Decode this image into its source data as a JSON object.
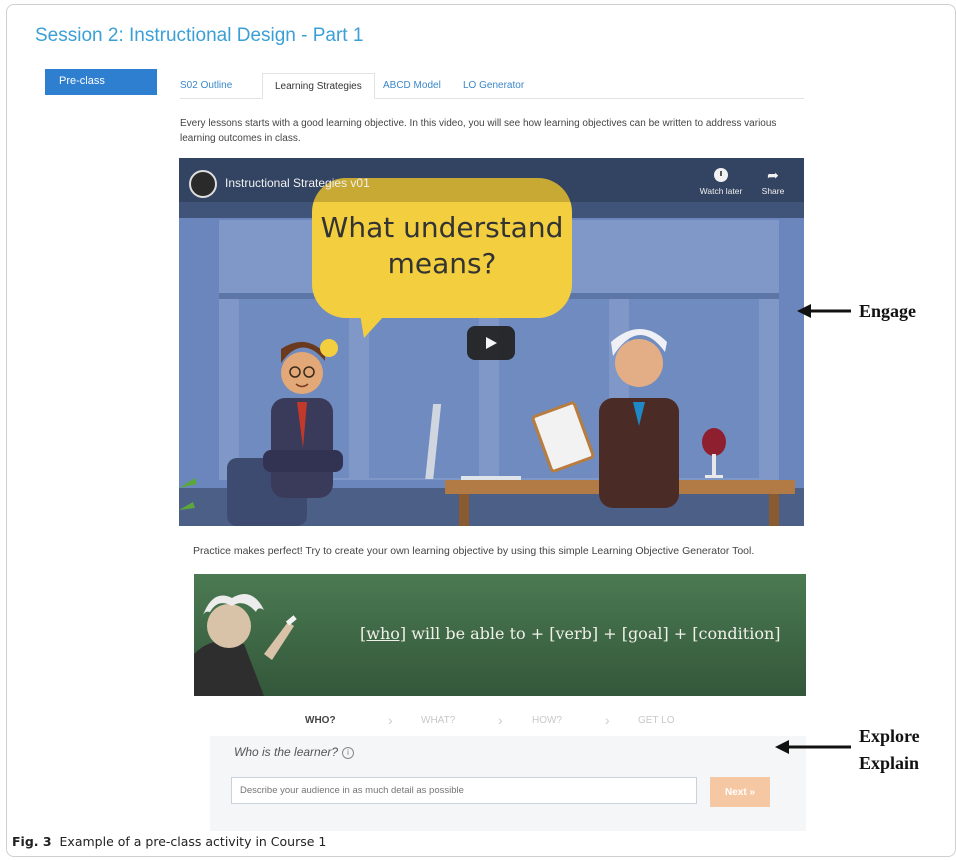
{
  "session": {
    "title": "Session 2: Instructional Design - Part 1"
  },
  "sidebar": {
    "preclass_label": "Pre-class"
  },
  "tabs": [
    {
      "label": "S02 Outline"
    },
    {
      "label": "Learning Strategies",
      "active": true
    },
    {
      "label": "ABCD Model"
    },
    {
      "label": "LO Generator"
    }
  ],
  "intro_text": "Every lessons starts with a good learning objective. In this video, you will see how learning objectives can be written to address various learning outcomes in class.",
  "video": {
    "title": "Instructional Strategies v01",
    "bubble_line1": "What understand",
    "bubble_line2": "means?",
    "watch_later": "Watch later",
    "share": "Share",
    "icons": [
      "clock-icon",
      "share-icon",
      "play-icon"
    ]
  },
  "annotations": {
    "engage": "Engage",
    "explore": "Explore",
    "explain": "Explain"
  },
  "practice_text": "Practice makes perfect! Try to create your own learning objective by using this simple Learning Objective Generator Tool.",
  "chalkboard": {
    "who": "[who]",
    "formula_rest": " will be able to + [verb] + [goal] + [condition]"
  },
  "steps": [
    {
      "label": "WHO?",
      "active": true
    },
    {
      "label": "WHAT?"
    },
    {
      "label": "HOW?"
    },
    {
      "label": "GET LO"
    }
  ],
  "form": {
    "question": "Who is the learner?",
    "info_glyph": "i",
    "placeholder": "Describe your audience in as much detail as possible",
    "next_label": "Next »"
  },
  "caption": {
    "label": "Fig. 3",
    "text": "Example of a pre-class activity in Course 1"
  },
  "colors": {
    "accent": "#2f7fd0",
    "link": "#3b87c8",
    "title": "#3b9fd6",
    "bubble": "#f3cf3f",
    "board": "#3f6b45",
    "next": "#f6c7a3"
  }
}
